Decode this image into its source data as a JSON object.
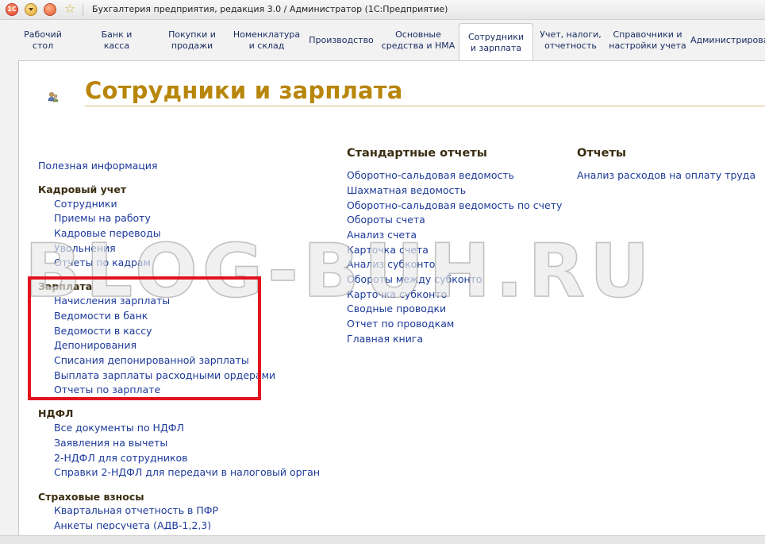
{
  "window": {
    "title": "Бухгалтерия предприятия, редакция 3.0 / Администратор  (1С:Предприятие)",
    "logo_text": "1С"
  },
  "tabs": [
    {
      "label": "Рабочий\nстол"
    },
    {
      "label": "Банк и\nкасса"
    },
    {
      "label": "Покупки и\nпродажи"
    },
    {
      "label": "Номенклатура\nи склад"
    },
    {
      "label": "Производство"
    },
    {
      "label": "Основные\nсредства и НМА"
    },
    {
      "label": "Сотрудники\nи зарплата",
      "active": true
    },
    {
      "label": "Учет, налоги,\nотчетность"
    },
    {
      "label": "Справочники и\nнастройки учета"
    },
    {
      "label": "Администрирование"
    }
  ],
  "page": {
    "title": "Сотрудники и зарплата",
    "icon": "employees-icon"
  },
  "left": {
    "useful_info": "Полезная информация",
    "hr": {
      "title": "Кадровый учет",
      "items": [
        "Сотрудники",
        "Приемы на работу",
        "Кадровые переводы",
        "Увольнения",
        "Отчеты по кадрам"
      ]
    },
    "salary": {
      "title": "Зарплата",
      "items": [
        "Начисления зарплаты",
        "Ведомости в банк",
        "Ведомости в кассу",
        "Депонирования",
        "Списания депонированной зарплаты",
        "Выплата зарплаты расходными ордерами",
        "Отчеты по зарплате"
      ]
    },
    "ndfl": {
      "title": "НДФЛ",
      "items": [
        "Все документы по НДФЛ",
        "Заявления на вычеты",
        "2-НДФЛ для сотрудников",
        "Справки 2-НДФЛ для передачи в налоговый орган"
      ]
    },
    "insurance": {
      "title": "Страховые взносы",
      "items": [
        "Квартальная отчетность в ПФР",
        "Анкеты персучета (АДВ-1,2,3)"
      ]
    }
  },
  "standard_reports": {
    "title": "Стандартные отчеты",
    "items": [
      "Оборотно-сальдовая ведомость",
      "Шахматная ведомость",
      "Оборотно-сальдовая ведомость по счету",
      "Обороты счета",
      "Анализ счета",
      "Карточка счета",
      "Анализ субконто",
      "Обороты между субконто",
      "Карточка субконто",
      "Сводные проводки",
      "Отчет по проводкам",
      "Главная книга"
    ]
  },
  "reports": {
    "title": "Отчеты",
    "items": [
      "Анализ расходов на оплату труда"
    ]
  },
  "watermark": "BLOG-BUH.RU",
  "colors": {
    "title": "#b8860b",
    "link": "#1c3a9a",
    "highlight": "#e3131f"
  }
}
